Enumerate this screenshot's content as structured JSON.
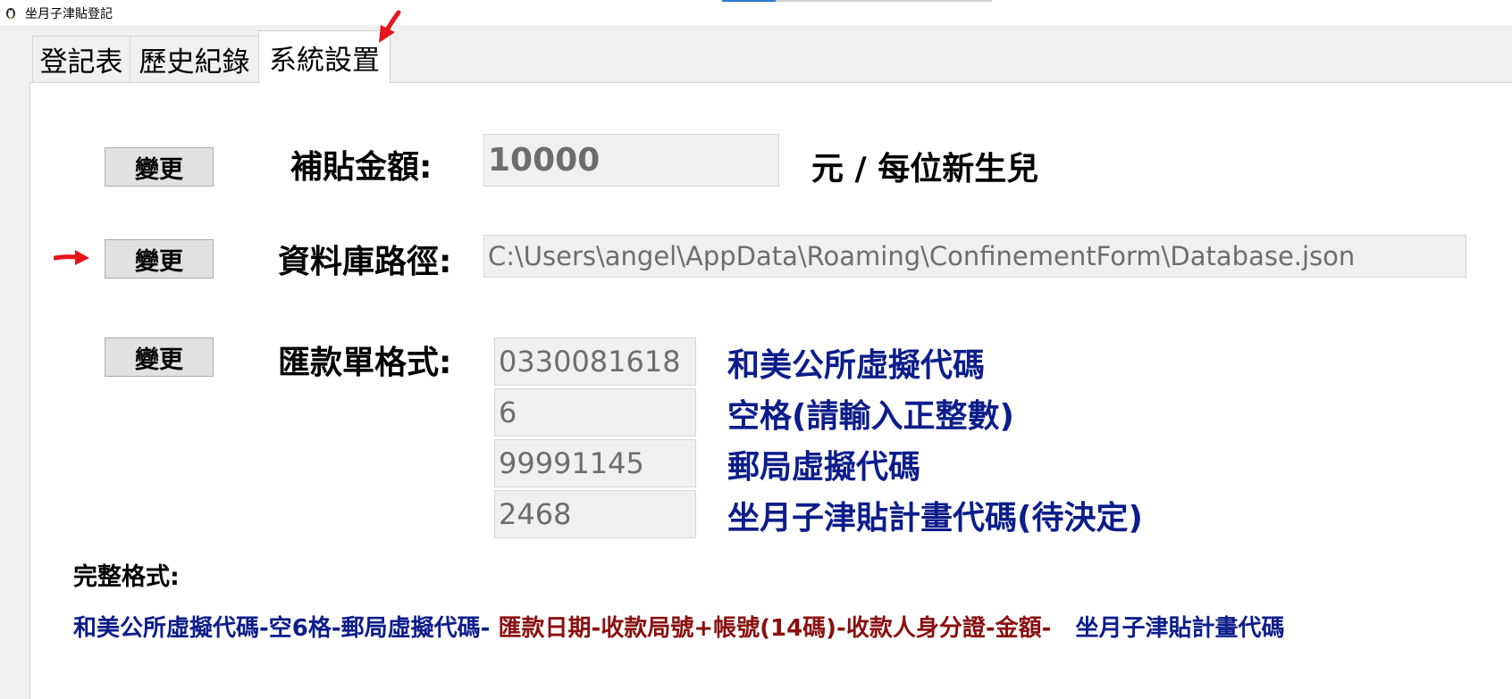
{
  "window": {
    "title": "坐月子津貼登記",
    "icon": "app-penguin-icon"
  },
  "tabs": [
    {
      "label": "登記表",
      "active": false
    },
    {
      "label": "歷史紀錄",
      "active": false
    },
    {
      "label": "系統設置",
      "active": true
    }
  ],
  "settings": {
    "subsidy": {
      "button_label": "變更",
      "label": "補貼金額:",
      "value": "10000",
      "unit": "元 / 每位新生兒"
    },
    "database": {
      "button_label": "變更",
      "label": "資料庫路徑:",
      "value": "C:\\Users\\angel\\AppData\\Roaming\\ConfinementForm\\Database.json"
    },
    "remittance": {
      "button_label": "變更",
      "label": "匯款單格式:",
      "fields": [
        {
          "value": "0330081618",
          "desc": "和美公所虛擬代碼"
        },
        {
          "value": "6",
          "desc": "空格(請輸入正整數)"
        },
        {
          "value": "99991145",
          "desc": "郵局虛擬代碼"
        },
        {
          "value": "2468",
          "desc": "坐月子津貼計畫代碼(待決定)"
        }
      ]
    },
    "full_format": {
      "label": "完整格式:",
      "part_blue_1": "和美公所虛擬代碼-空6格-郵局虛擬代碼-",
      "part_red": "匯款日期-收款局號+帳號(14碼)-收款人身分證-金額-",
      "part_blue_2": "坐月子津貼計畫代碼"
    }
  },
  "annotations": {
    "arrow_color": "#e8141b",
    "text_blue": "#0d1d8a",
    "text_red": "#8a1010"
  }
}
